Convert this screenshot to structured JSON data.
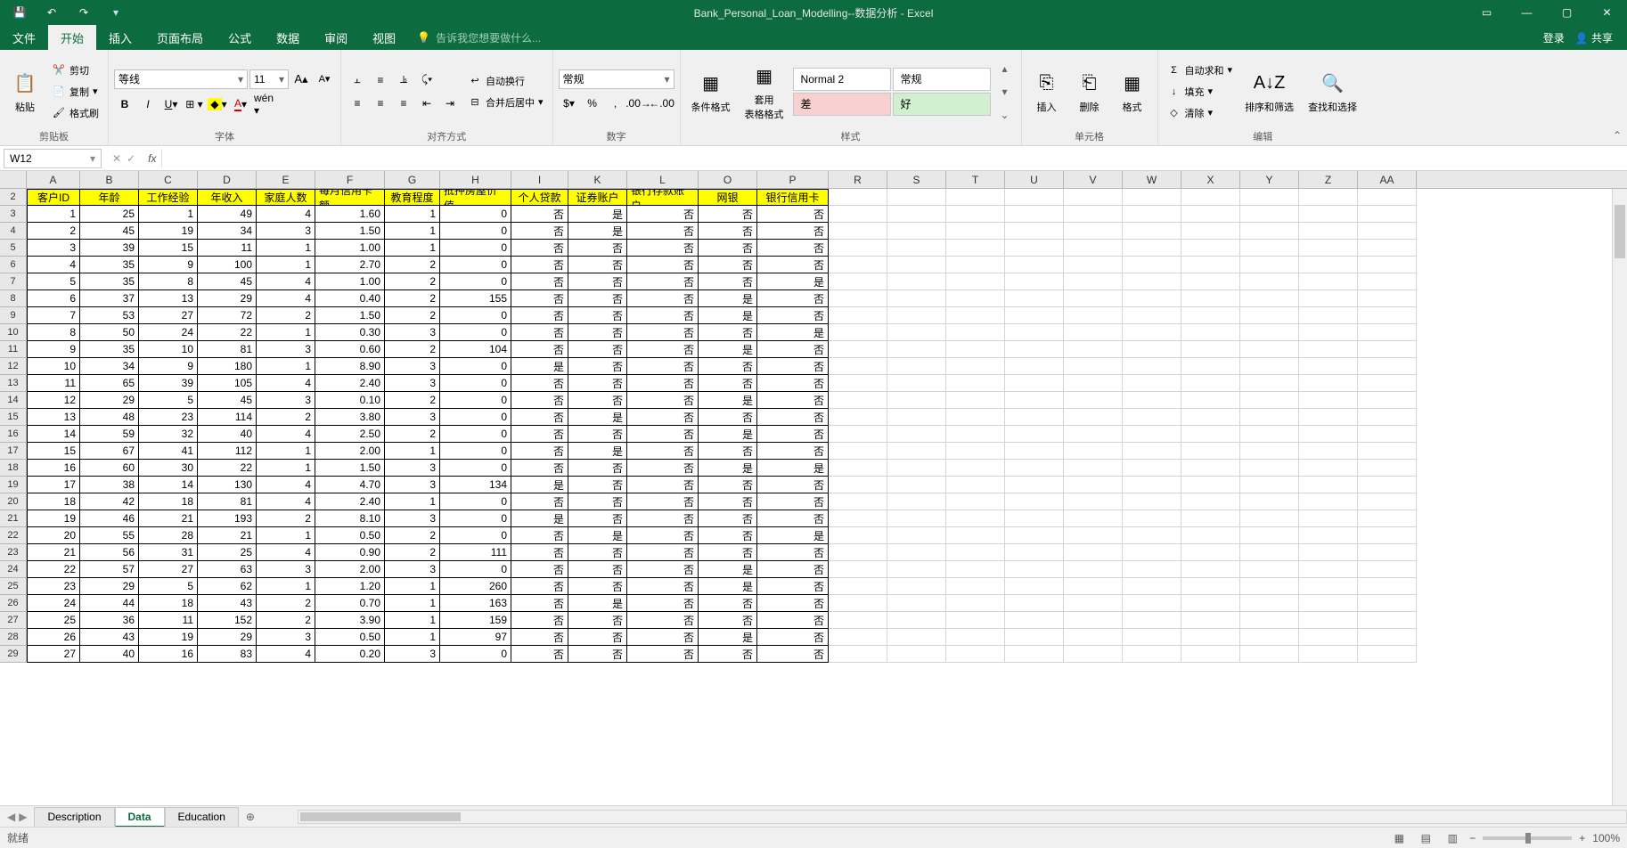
{
  "title": "Bank_Personal_Loan_Modelling--数据分析 - Excel",
  "qat": {
    "save": "💾",
    "undo": "↶",
    "redo": "↷"
  },
  "tabs": {
    "file": "文件",
    "items": [
      "开始",
      "插入",
      "页面布局",
      "公式",
      "数据",
      "审阅",
      "视图"
    ],
    "active": "开始",
    "tell_me_placeholder": "告诉我您想要做什么...",
    "login": "登录",
    "share": "共享"
  },
  "ribbon": {
    "clipboard": {
      "paste": "粘贴",
      "cut": "剪切",
      "copy": "复制",
      "brush": "格式刷",
      "label": "剪贴板"
    },
    "font": {
      "name": "等线",
      "size": "11",
      "label": "字体"
    },
    "alignment": {
      "wrap": "自动换行",
      "merge": "合并后居中",
      "label": "对齐方式"
    },
    "number": {
      "format": "常规",
      "label": "数字"
    },
    "styles": {
      "cond_format": "条件格式",
      "table_format": "套用\n表格格式",
      "normal2": "Normal 2",
      "changui": "常规",
      "cha": "差",
      "hao": "好",
      "label": "样式"
    },
    "cells": {
      "insert": "插入",
      "delete": "删除",
      "format": "格式",
      "label": "单元格"
    },
    "editing": {
      "autosum": "自动求和",
      "fill": "填充",
      "clear": "清除",
      "sort": "排序和筛选",
      "find": "查找和选择",
      "label": "编辑"
    }
  },
  "formula_bar": {
    "name_box": "W12",
    "formula": ""
  },
  "columns": [
    "A",
    "B",
    "C",
    "D",
    "E",
    "F",
    "G",
    "H",
    "I",
    "K",
    "L",
    "O",
    "P",
    "R",
    "S",
    "T",
    "U",
    "V",
    "W",
    "X",
    "Y",
    "Z",
    "AA"
  ],
  "col_widths_data": [
    60,
    66,
    66,
    66,
    66,
    78,
    62,
    80,
    64,
    66,
    80,
    66,
    80
  ],
  "col_width_blank": 66,
  "data_headers": [
    "客户ID",
    "年龄",
    "工作经验",
    "年收入",
    "家庭人数",
    "每月信用卡额",
    "教育程度",
    "抵押房屋价值",
    "个人贷款",
    "证券账户",
    "银行存款账户",
    "网银",
    "银行信用卡"
  ],
  "data_rows": [
    [
      1,
      25,
      1,
      49,
      4,
      "1.60",
      1,
      0,
      "否",
      "是",
      "否",
      "否",
      "否"
    ],
    [
      2,
      45,
      19,
      34,
      3,
      "1.50",
      1,
      0,
      "否",
      "是",
      "否",
      "否",
      "否"
    ],
    [
      3,
      39,
      15,
      11,
      1,
      "1.00",
      1,
      0,
      "否",
      "否",
      "否",
      "否",
      "否"
    ],
    [
      4,
      35,
      9,
      100,
      1,
      "2.70",
      2,
      0,
      "否",
      "否",
      "否",
      "否",
      "否"
    ],
    [
      5,
      35,
      8,
      45,
      4,
      "1.00",
      2,
      0,
      "否",
      "否",
      "否",
      "否",
      "是"
    ],
    [
      6,
      37,
      13,
      29,
      4,
      "0.40",
      2,
      155,
      "否",
      "否",
      "否",
      "是",
      "否"
    ],
    [
      7,
      53,
      27,
      72,
      2,
      "1.50",
      2,
      0,
      "否",
      "否",
      "否",
      "是",
      "否"
    ],
    [
      8,
      50,
      24,
      22,
      1,
      "0.30",
      3,
      0,
      "否",
      "否",
      "否",
      "否",
      "是"
    ],
    [
      9,
      35,
      10,
      81,
      3,
      "0.60",
      2,
      104,
      "否",
      "否",
      "否",
      "是",
      "否"
    ],
    [
      10,
      34,
      9,
      180,
      1,
      "8.90",
      3,
      0,
      "是",
      "否",
      "否",
      "否",
      "否"
    ],
    [
      11,
      65,
      39,
      105,
      4,
      "2.40",
      3,
      0,
      "否",
      "否",
      "否",
      "否",
      "否"
    ],
    [
      12,
      29,
      5,
      45,
      3,
      "0.10",
      2,
      0,
      "否",
      "否",
      "否",
      "是",
      "否"
    ],
    [
      13,
      48,
      23,
      114,
      2,
      "3.80",
      3,
      0,
      "否",
      "是",
      "否",
      "否",
      "否"
    ],
    [
      14,
      59,
      32,
      40,
      4,
      "2.50",
      2,
      0,
      "否",
      "否",
      "否",
      "是",
      "否"
    ],
    [
      15,
      67,
      41,
      112,
      1,
      "2.00",
      1,
      0,
      "否",
      "是",
      "否",
      "否",
      "否"
    ],
    [
      16,
      60,
      30,
      22,
      1,
      "1.50",
      3,
      0,
      "否",
      "否",
      "否",
      "是",
      "是"
    ],
    [
      17,
      38,
      14,
      130,
      4,
      "4.70",
      3,
      134,
      "是",
      "否",
      "否",
      "否",
      "否"
    ],
    [
      18,
      42,
      18,
      81,
      4,
      "2.40",
      1,
      0,
      "否",
      "否",
      "否",
      "否",
      "否"
    ],
    [
      19,
      46,
      21,
      193,
      2,
      "8.10",
      3,
      0,
      "是",
      "否",
      "否",
      "否",
      "否"
    ],
    [
      20,
      55,
      28,
      21,
      1,
      "0.50",
      2,
      0,
      "否",
      "是",
      "否",
      "否",
      "是"
    ],
    [
      21,
      56,
      31,
      25,
      4,
      "0.90",
      2,
      111,
      "否",
      "否",
      "否",
      "否",
      "否"
    ],
    [
      22,
      57,
      27,
      63,
      3,
      "2.00",
      3,
      0,
      "否",
      "否",
      "否",
      "是",
      "否"
    ],
    [
      23,
      29,
      5,
      62,
      1,
      "1.20",
      1,
      260,
      "否",
      "否",
      "否",
      "是",
      "否"
    ],
    [
      24,
      44,
      18,
      43,
      2,
      "0.70",
      1,
      163,
      "否",
      "是",
      "否",
      "否",
      "否"
    ],
    [
      25,
      36,
      11,
      152,
      2,
      "3.90",
      1,
      159,
      "否",
      "否",
      "否",
      "否",
      "否"
    ],
    [
      26,
      43,
      19,
      29,
      3,
      "0.50",
      1,
      97,
      "否",
      "否",
      "否",
      "是",
      "否"
    ],
    [
      27,
      40,
      16,
      83,
      4,
      "0.20",
      3,
      0,
      "否",
      "否",
      "否",
      "否",
      "否"
    ]
  ],
  "sheets": {
    "items": [
      "Description",
      "Data",
      "Education"
    ],
    "active": "Data"
  },
  "status": {
    "ready": "就绪",
    "zoom": "100%"
  }
}
